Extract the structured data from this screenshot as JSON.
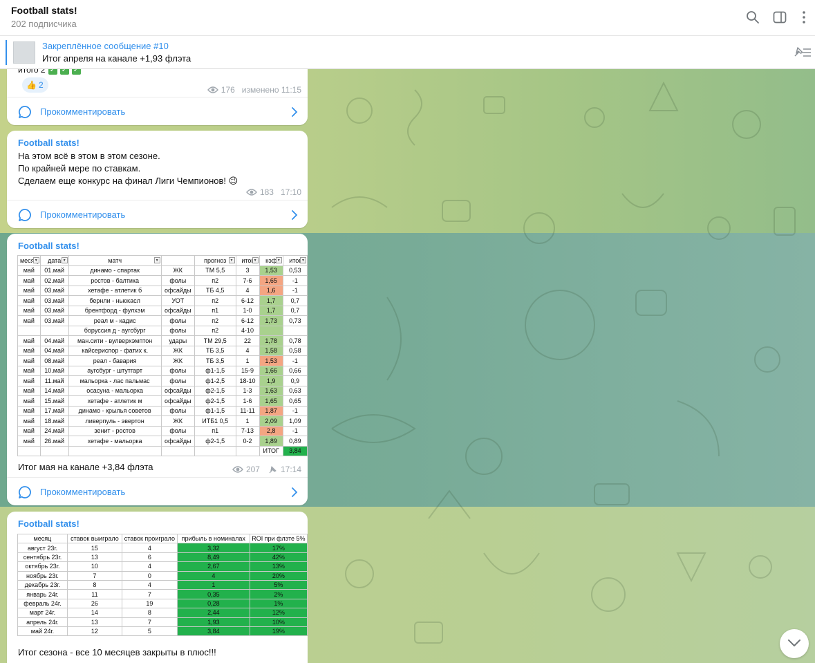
{
  "header": {
    "title": "Football stats!",
    "subtitle": "202 подписчика"
  },
  "pinned": {
    "title": "Закреплённое сообщение #10",
    "text": "Итог апреля на канале +1,93 флэта"
  },
  "posts": [
    {
      "partial_text": "итого 2",
      "reaction": {
        "emoji": "👍",
        "count": "2"
      },
      "views": "176",
      "time": "изменено 11:15",
      "comment_label": "Прокомментировать"
    },
    {
      "author": "Football stats!",
      "lines": [
        "На этом всё в этом в этом сезоне.",
        "По крайней мере по ставкам.",
        "Сделаем еще конкурс на финал Лиги Чемпионов! 😉"
      ],
      "views": "183",
      "time": "17:10",
      "comment_label": "Прокомментировать"
    },
    {
      "author": "Football stats!",
      "caption": "Итог мая на канале +3,84 флэта",
      "views": "207",
      "time": "17:14",
      "comment_label": "Прокомментировать"
    },
    {
      "author": "Football stats!",
      "caption": "Итог сезона - все 10 месяцев закрыты в плюс!!!"
    }
  ],
  "may_sheet": {
    "headers": [
      "месяц",
      "дата",
      "матч",
      "",
      "прогноз",
      "итог",
      "кэф",
      "итог"
    ],
    "rows": [
      [
        "май",
        "01.май",
        "динамо - спартак",
        "ЖК",
        "ТМ 5,5",
        "3",
        "1,53",
        "0,53"
      ],
      [
        "май",
        "02.май",
        "ростов - балтика",
        "фолы",
        "п2",
        "7-6",
        "1,65",
        "-1"
      ],
      [
        "май",
        "03.май",
        "хетафе - атлетик б",
        "офсайды",
        "ТБ 4,5",
        "4",
        "1,6",
        "-1"
      ],
      [
        "май",
        "03.май",
        "бернли - ньюкасл",
        "УОТ",
        "п2",
        "6-12",
        "1,7",
        "0,7"
      ],
      [
        "май",
        "03.май",
        "брентфорд - фулхэм",
        "офсайды",
        "п1",
        "1-0",
        "1,7",
        "0,7"
      ],
      [
        "май",
        "03.май",
        "реал м - кадис",
        "фолы",
        "п2",
        "6-12",
        "1,73",
        "0,73"
      ],
      [
        "",
        "",
        "боруссия д - аугсбург",
        "фолы",
        "п2",
        "4-10",
        "",
        ""
      ],
      [
        "май",
        "04.май",
        "ман.сити - вулверхэмптон",
        "удары",
        "ТМ 29,5",
        "22",
        "1,78",
        "0,78"
      ],
      [
        "май",
        "04.май",
        "кайсериспор - фатих к.",
        "ЖК",
        "ТБ 3,5",
        "4",
        "1,58",
        "0,58"
      ],
      [
        "май",
        "08.май",
        "реал - бавария",
        "ЖК",
        "ТБ 3,5",
        "1",
        "1,53",
        "-1"
      ],
      [
        "май",
        "10.май",
        "аугсбург - штутгарт",
        "фолы",
        "ф1-1,5",
        "15-9",
        "1,66",
        "0,66"
      ],
      [
        "май",
        "11.май",
        "мальорка - лас пальмас",
        "фолы",
        "ф1-2,5",
        "18-10",
        "1,9",
        "0,9"
      ],
      [
        "май",
        "14.май",
        "осасуна - мальорка",
        "офсайды",
        "ф2-1,5",
        "1-3",
        "1,63",
        "0,63"
      ],
      [
        "май",
        "15.май",
        "хетафе - атлетик м",
        "офсайды",
        "ф2-1,5",
        "1-6",
        "1,65",
        "0,65"
      ],
      [
        "май",
        "17.май",
        "динамо - крылья советов",
        "фолы",
        "ф1-1,5",
        "11-11",
        "1,87",
        "-1"
      ],
      [
        "май",
        "18.май",
        "ливерпуль - эвертон",
        "ЖК",
        "ИТБ1 0,5",
        "1",
        "2,09",
        "1,09"
      ],
      [
        "май",
        "24.май",
        "зенит - ростов",
        "фолы",
        "п1",
        "7-13",
        "2,8",
        "-1"
      ],
      [
        "май",
        "26.май",
        "хетафе - мальорка",
        "офсайды",
        "ф2-1,5",
        "0-2",
        "1,89",
        "0,89"
      ]
    ],
    "total_label": "ИТОГ",
    "total_value": "3,84"
  },
  "season_table": {
    "headers": [
      "месяц",
      "ставок выиграло",
      "ставок проиграло",
      "прибыль в номиналах",
      "ROI при флэте 5%"
    ],
    "rows": [
      [
        "август 23г.",
        "15",
        "4",
        "3,32",
        "17%"
      ],
      [
        "сентябрь 23г.",
        "13",
        "6",
        "8,49",
        "42%"
      ],
      [
        "октябрь 23г.",
        "10",
        "4",
        "2,67",
        "13%"
      ],
      [
        "ноябрь 23г.",
        "7",
        "0",
        "4",
        "20%"
      ],
      [
        "декабрь 23г.",
        "8",
        "4",
        "1",
        "5%"
      ],
      [
        "январь 24г.",
        "11",
        "7",
        "0,35",
        "2%"
      ],
      [
        "февраль 24г.",
        "26",
        "19",
        "0,28",
        "1%"
      ],
      [
        "март 24г.",
        "14",
        "8",
        "2,44",
        "12%"
      ],
      [
        "апрель 24г.",
        "13",
        "7",
        "1,93",
        "10%"
      ],
      [
        "май 24г.",
        "12",
        "5",
        "3,84",
        "19%"
      ]
    ]
  },
  "colors": {
    "accent": "#3390ec",
    "positive_cell": "#22b14c",
    "kef_green": "#a9d18e",
    "kef_red": "#f4a582"
  }
}
